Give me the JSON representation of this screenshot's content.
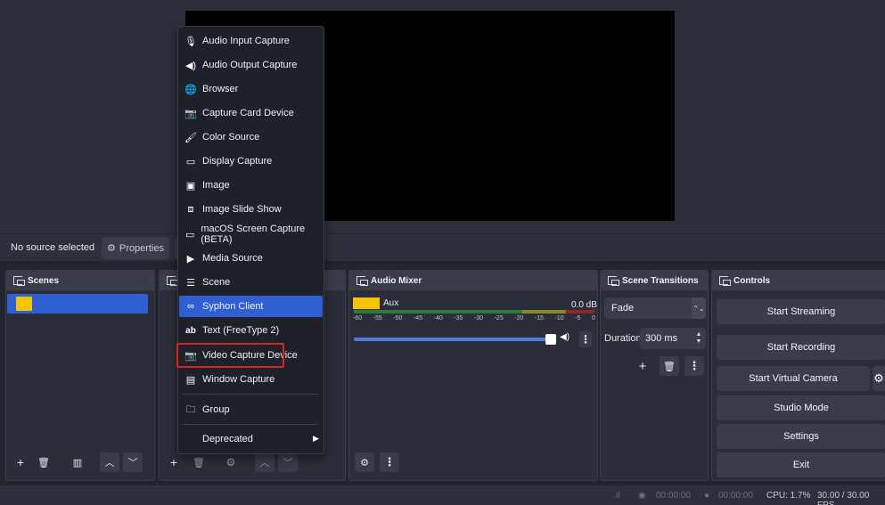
{
  "source_bar": {
    "no_source_label": "No source selected",
    "properties_label": "Properties"
  },
  "docks": {
    "scenes": "Scenes",
    "sources": "S",
    "audio_mixer": "Audio Mixer",
    "scene_transitions": "Scene Transitions",
    "controls": "Controls"
  },
  "mixer": {
    "track_name": "Aux",
    "level": "0.0 dB",
    "ticks": [
      "-60",
      "-55",
      "-50",
      "-45",
      "-40",
      "-35",
      "-30",
      "-25",
      "-20",
      "-15",
      "-10",
      "-5",
      "0"
    ]
  },
  "transitions": {
    "selected": "Fade",
    "duration_label": "Duration",
    "duration_value": "300 ms"
  },
  "controls": {
    "start_streaming": "Start Streaming",
    "start_recording": "Start Recording",
    "start_virtual_camera": "Start Virtual Camera",
    "studio_mode": "Studio Mode",
    "settings": "Settings",
    "exit": "Exit"
  },
  "status": {
    "stream_time": "00:00:00",
    "record_time": "00:00:00",
    "cpu": "CPU: 1.7%",
    "fps": "30.00 / 30.00 FPS"
  },
  "context_menu": {
    "items": [
      {
        "label": "Audio Input Capture",
        "icon": "microphone-icon"
      },
      {
        "label": "Audio Output Capture",
        "icon": "speaker-icon"
      },
      {
        "label": "Browser",
        "icon": "globe-icon"
      },
      {
        "label": "Capture Card Device",
        "icon": "camera-icon"
      },
      {
        "label": "Color Source",
        "icon": "brush-icon"
      },
      {
        "label": "Display Capture",
        "icon": "monitor-icon"
      },
      {
        "label": "Image",
        "icon": "image-icon"
      },
      {
        "label": "Image Slide Show",
        "icon": "slideshow-icon"
      },
      {
        "label": "macOS Screen Capture (BETA)",
        "icon": "monitor-icon"
      },
      {
        "label": "Media Source",
        "icon": "play-icon"
      },
      {
        "label": "Scene",
        "icon": "list-icon"
      },
      {
        "label": "Syphon Client",
        "icon": "syphon-icon"
      },
      {
        "label": "Text (FreeType 2)",
        "icon": "text-icon"
      },
      {
        "label": "Video Capture Device",
        "icon": "camera-icon"
      },
      {
        "label": "Window Capture",
        "icon": "window-icon"
      },
      {
        "label": "Group",
        "icon": "folder-icon"
      },
      {
        "label": "Deprecated",
        "icon": ""
      }
    ]
  },
  "colors": {
    "accent": "#2f5fd0",
    "scene_swatch": "#f5c400",
    "highlight_box": "#d6231c"
  }
}
